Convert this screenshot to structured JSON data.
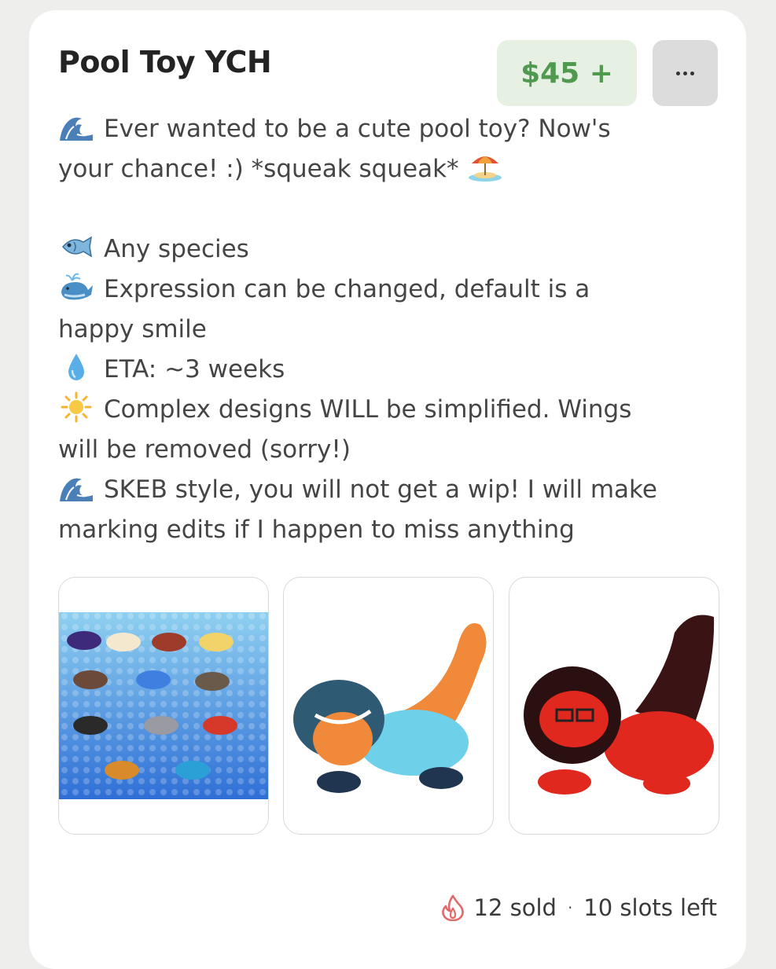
{
  "listing": {
    "title": "Pool Toy YCH",
    "price": "$45 +",
    "more_label": "..."
  },
  "description": {
    "intro_line1": "Ever wanted to be a cute pool toy? Now's",
    "intro_line2": "your chance! :) *squeak squeak*",
    "species": "Any species",
    "expression_line1": "Expression can be changed, default is a",
    "expression_line2": "happy smile",
    "eta": "ETA: ~3 weeks",
    "complex_line1": "Complex designs WILL be simplified. Wings",
    "complex_line2": "will be removed (sorry!)",
    "skeb_line1": "SKEB style, you will not get a wip! I will make",
    "skeb_line2": "marking edits if I happen to miss anything"
  },
  "icons": {
    "wave": "wave-icon",
    "beach_umbrella": "beach-umbrella-icon",
    "fish": "fish-icon",
    "whale": "spouting-whale-icon",
    "droplet": "droplet-icon",
    "sun": "sun-icon",
    "flame": "flame-icon"
  },
  "gallery": {
    "images": [
      "sheet-of-pool-toy-examples",
      "blue-orange-dragon-pool-toy",
      "red-black-furry-pool-toy"
    ]
  },
  "stats": {
    "sold": "12 sold",
    "separator": "·",
    "slots": "10 slots left"
  },
  "colors": {
    "price_bg": "#e6f1e3",
    "price_text": "#4f9a4f",
    "flame": "#e06a6a"
  }
}
